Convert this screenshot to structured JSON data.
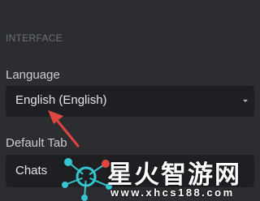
{
  "section": {
    "title": "INTERFACE"
  },
  "language": {
    "label": "Language",
    "value": "English (English)",
    "icon": "chevron-down-icon"
  },
  "default_tab": {
    "label": "Default Tab",
    "value": "Chats"
  },
  "watermark": {
    "title": "星火智游网",
    "url": "www.xhcs188.com"
  },
  "colors": {
    "background": "#2b2d31",
    "select_bg": "#1e1f22",
    "arrow": "#e0463f"
  }
}
